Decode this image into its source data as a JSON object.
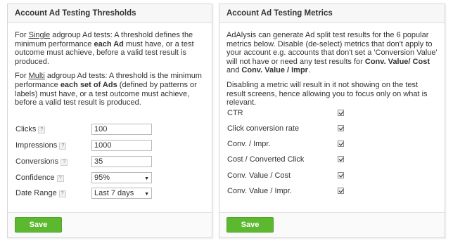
{
  "thresholds": {
    "title": "Account Ad Testing Thresholds",
    "single_prefix": "For ",
    "single_word": "Single",
    "single_mid": " adgroup Ad tests: A threshold defines the minimum performance ",
    "single_bold": "each Ad",
    "single_suffix": " must have, or a test outcome must achieve, before a valid test result is produced.",
    "multi_prefix": "For ",
    "multi_word": "Multi",
    "multi_mid": " adgroup Ad tests: A threshold is the minimum performance ",
    "multi_bold": "each set of Ads",
    "multi_suffix": " (defined by patterns or labels) must have, or a test outcome must achieve, before a valid test result is produced.",
    "fields": [
      {
        "label": "Clicks",
        "value": "100"
      },
      {
        "label": "Impressions",
        "value": "1000"
      },
      {
        "label": "Conversions",
        "value": "35"
      }
    ],
    "confidence": {
      "label": "Confidence",
      "value": "95%"
    },
    "date_range": {
      "label": "Date Range",
      "value": "Last 7 days"
    },
    "help_glyph": "?",
    "save_label": "Save"
  },
  "metrics": {
    "title": "Account Ad Testing Metrics",
    "intro_text": "AdAlysis can generate Ad split test results for the 6 popular metrics below. Disable (de-select) metrics that don't apply to your account e.g. accounts that don't set a 'Conversion Value' will not have or need any test results for ",
    "intro_bold1": "Conv. Value/ Cost",
    "intro_and": " and ",
    "intro_bold2": "Conv. Value / Impr",
    "intro_end": ".",
    "note": "Disabling a metric will result in it not showing on the test result screens, hence allowing you to focus only on what is relevant.",
    "items": [
      {
        "label": "CTR",
        "checked": true
      },
      {
        "label": "Click conversion rate",
        "checked": true
      },
      {
        "label": "Conv. / Impr.",
        "checked": true
      },
      {
        "label": "Cost / Converted Click",
        "checked": true
      },
      {
        "label": "Conv. Value / Cost",
        "checked": true
      },
      {
        "label": "Conv. Value / Impr.",
        "checked": true
      }
    ],
    "save_label": "Save"
  }
}
